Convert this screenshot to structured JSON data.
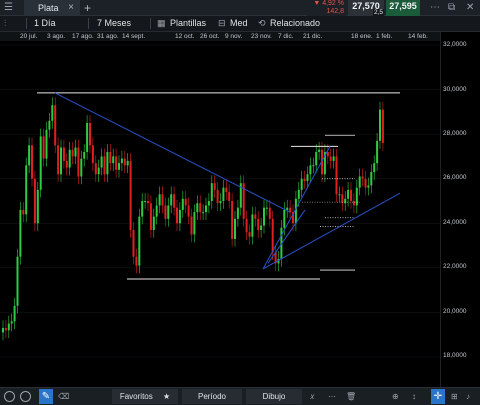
{
  "tabbar": {
    "tab_label": "Plata",
    "close": "×",
    "add": "+"
  },
  "toolbar": {
    "interval": "1 Día",
    "range": "7 Meses",
    "templates": "Plantillas",
    "price_type": "Med",
    "related": "Relacionado"
  },
  "quote": {
    "change_pct": "▼ 4,92 %",
    "change_abs": "142,8",
    "sell": "27,570",
    "buy": "27,595",
    "spread": "2,5"
  },
  "date_axis": [
    {
      "label": "20 jul."
    },
    {
      "label": "3 ago."
    },
    {
      "label": "17 ago."
    },
    {
      "label": "31 ago."
    },
    {
      "label": "14 sept."
    },
    {
      "label": "12 oct."
    },
    {
      "label": "26 oct."
    },
    {
      "label": "9 nov."
    },
    {
      "label": "23 nov."
    },
    {
      "label": "7 dic."
    },
    {
      "label": "21 dic."
    },
    {
      "label": "18 ene."
    },
    {
      "label": "1 feb."
    },
    {
      "label": "14 feb."
    }
  ],
  "price_axis": [
    "32,0000",
    "30,0000",
    "28,0000",
    "26,0000",
    "24,0000",
    "22,0000",
    "20,0000",
    "18,0000"
  ],
  "bottom": {
    "favorites": "Favoritos",
    "period": "Período",
    "drawing": "Dibujo"
  },
  "colors": {
    "up": "#2ecc40",
    "down": "#e02020",
    "trendline": "#2a52c9",
    "level": "#e8e8e8",
    "accent": "#2a74c9"
  },
  "chart_data": {
    "type": "candlestick",
    "instrument": "Plata",
    "interval": "1 Día",
    "ylim": [
      17.0,
      32.6
    ],
    "hlines": [
      29.85,
      27.45,
      26.0,
      24.3,
      23.9,
      21.5
    ],
    "candles_close": [
      19.3,
      19.2,
      19.5,
      19.6,
      20.3,
      22.5,
      24.6,
      24.4,
      26.6,
      27.5,
      26.0,
      24.0,
      25.5,
      27.9,
      26.9,
      28.2,
      28.6,
      29.3,
      27.5,
      26.2,
      27.4,
      26.8,
      26.5,
      27.3,
      27.0,
      27.4,
      26.1,
      26.9,
      27.2,
      28.5,
      27.5,
      26.7,
      26.2,
      26.5,
      27.0,
      26.2,
      27.2,
      26.7,
      27.0,
      26.4,
      26.7,
      26.9,
      26.6,
      26.8,
      23.7,
      22.5,
      22.1,
      24.3,
      25.0,
      25.0,
      24.9,
      23.7,
      24.3,
      24.8,
      25.3,
      24.8,
      24.2,
      24.8,
      25.3,
      24.7,
      24.0,
      24.6,
      25.1,
      24.8,
      24.3,
      23.5,
      24.5,
      24.9,
      24.5,
      24.5,
      24.8,
      25.0,
      25.8,
      25.5,
      24.9,
      25.0,
      25.6,
      25.4,
      25.0,
      23.3,
      24.2,
      24.7,
      25.8,
      24.2,
      23.6,
      23.4,
      24.4,
      24.2,
      23.7,
      23.9,
      24.7,
      24.7,
      24.2,
      22.7,
      22.2,
      22.4,
      23.8,
      24.6,
      24.7,
      24.5,
      24.0,
      25.1,
      25.5,
      26.0,
      25.9,
      26.2,
      26.6,
      26.6,
      27.2,
      27.3,
      26.2,
      27.2,
      27.0,
      26.8,
      27.0,
      25.3,
      25.3,
      24.9,
      25.1,
      25.5,
      25.0,
      24.8,
      25.6,
      26.1,
      26.0,
      25.6,
      25.7,
      26.3,
      26.7,
      27.7,
      29.1,
      27.6
    ]
  }
}
